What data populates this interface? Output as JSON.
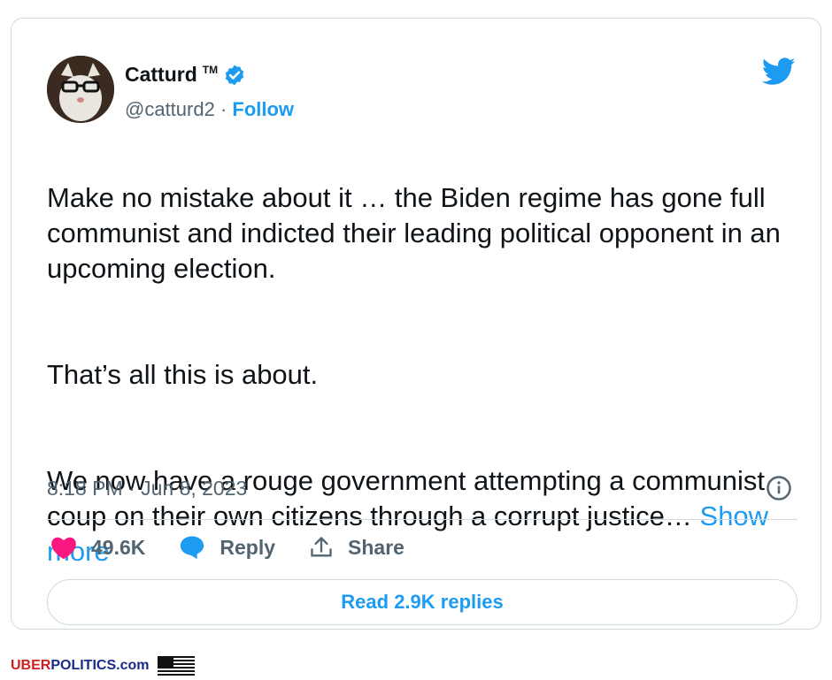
{
  "user": {
    "display_name": "Catturd",
    "tm": "TM",
    "handle": "@catturd2",
    "separator": " · ",
    "follow_label": "Follow"
  },
  "tweet": {
    "paragraphs": [
      "Make no mistake about it … the Biden regime has gone full communist and indicted their leading political opponent in an upcoming election.",
      "That’s all this is about.",
      "We now have a rouge government attempting a communist coup on their own citizens through a corrupt justice…"
    ],
    "show_more_label": "Show more",
    "timestamp": "8:18 PM · Jun 8, 2023"
  },
  "actions": {
    "likes": "49.6K",
    "reply_label": "Reply",
    "share_label": "Share"
  },
  "read_replies_label": "Read 2.9K replies",
  "footer": {
    "brand_part1": "UBER",
    "brand_part2": "POLITICS.com"
  },
  "colors": {
    "accent": "#1d9bf0",
    "like": "#f91880",
    "text": "#0f1419",
    "muted": "#536471"
  },
  "icons": [
    "avatar",
    "verified-badge-icon",
    "twitter-bird-icon",
    "info-icon",
    "heart-icon",
    "reply-bubble-icon",
    "share-icon",
    "us-flag-icon"
  ]
}
